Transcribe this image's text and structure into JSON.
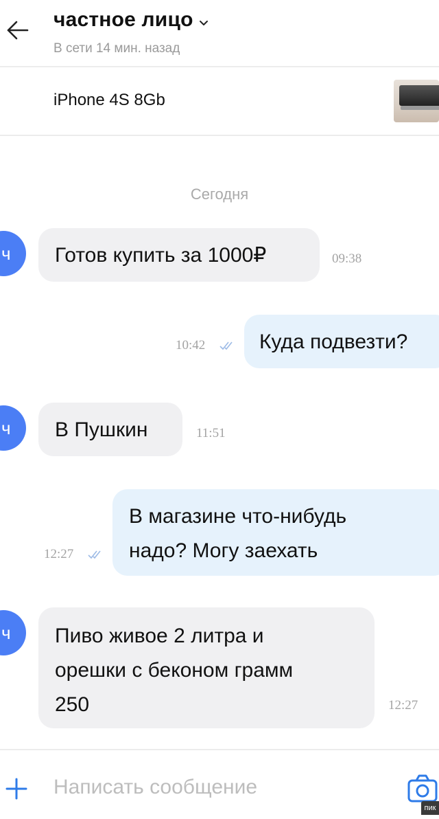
{
  "header": {
    "title": "частное лицо",
    "status": "В сети 14 мин. назад",
    "back_icon": "arrow-left-icon",
    "chevron_icon": "chevron-down-icon"
  },
  "product": {
    "title": "iPhone 4S 8Gb",
    "thumb_icon": "product-thumbnail"
  },
  "date_separator": "Сегодня",
  "messages": [
    {
      "direction": "in",
      "avatar": "ч",
      "lines": [
        "Готов купить за 1000₽"
      ],
      "time": "09:38"
    },
    {
      "direction": "out",
      "lines": [
        "Куда подвезти?"
      ],
      "time": "10:42",
      "read": true
    },
    {
      "direction": "in",
      "avatar": "ч",
      "lines": [
        "В Пушкин"
      ],
      "time": "11:51"
    },
    {
      "direction": "out",
      "lines": [
        "В магазине что-нибудь",
        "надо? Могу заехать"
      ],
      "time": "12:27",
      "read": true
    },
    {
      "direction": "in",
      "avatar": "ч",
      "lines": [
        "Пиво живое 2 литра и",
        "орешки с беконом грамм",
        "250"
      ],
      "time": "12:27"
    }
  ],
  "composer": {
    "placeholder": "Написать сообщение",
    "value": "",
    "plus_icon": "plus-icon",
    "camera_icon": "camera-icon"
  },
  "watermark": "пик",
  "colors": {
    "accent": "#4b7ef5",
    "incoming_bubble": "#f0f0f2",
    "outgoing_bubble": "#e6f2fc",
    "ticks": "#9dbbe6"
  }
}
